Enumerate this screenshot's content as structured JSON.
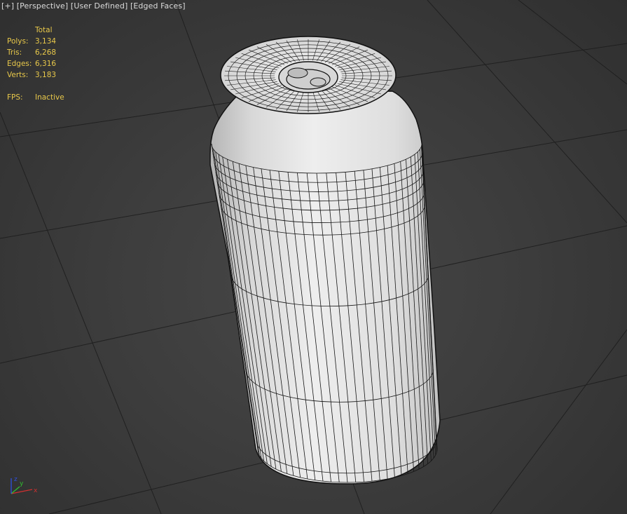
{
  "viewport": {
    "label_parts": [
      "[+]",
      "[Perspective]",
      "[User Defined]",
      "[Edged Faces]"
    ],
    "stats": {
      "header": "Total",
      "rows": [
        {
          "key": "Polys:",
          "value": "3,134"
        },
        {
          "key": "Tris:",
          "value": "6,268"
        },
        {
          "key": "Edges:",
          "value": "6,316"
        },
        {
          "key": "Verts:",
          "value": "3,183"
        }
      ],
      "fps_label": "FPS:",
      "fps_value": "Inactive"
    },
    "axis": {
      "x": "x",
      "y": "y",
      "z": "z"
    },
    "colors": {
      "background": "#3d3d3d",
      "grid": "#1a1a1a",
      "stats_text": "#e8c84a",
      "label_text": "#dcdcdc",
      "mesh_fill": "#e6e6e6",
      "mesh_edges": "#151515",
      "axis_x": "#d03030",
      "axis_y": "#30c030",
      "axis_z": "#3050e0"
    },
    "object": {
      "name": "soda-can",
      "shading": "Edged Faces"
    }
  }
}
